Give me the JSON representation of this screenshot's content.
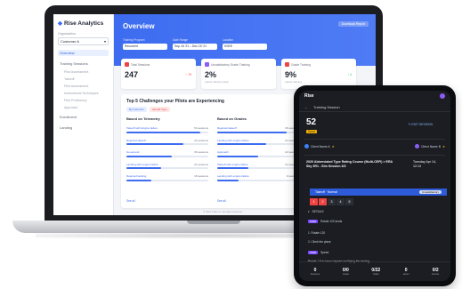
{
  "colors": {
    "accent": "#3d6cf0",
    "score_badge": "#f5b301",
    "alert_red": "#ef4444",
    "purple_tag": "#7c4dff"
  },
  "laptop": {
    "sidebar": {
      "brand": "Rise Analytics",
      "org_label": "Organization",
      "org_value": "Customer A",
      "items": [
        {
          "label": "Overview",
          "active": true
        },
        {
          "label": "Training Sessions",
          "active": false
        },
        {
          "label": "Pilot Assessment",
          "active": false,
          "sub": true
        },
        {
          "label": "Takeoff",
          "active": false,
          "sub": true
        },
        {
          "label": "Pilot Assessment",
          "active": false,
          "sub": true
        },
        {
          "label": "Instructional Techniques",
          "active": false,
          "sub": true
        },
        {
          "label": "Pilot Proficiency",
          "active": false,
          "sub": true
        },
        {
          "label": "Approach",
          "active": false,
          "sub": true
        },
        {
          "label": "Enrollment",
          "active": false
        },
        {
          "label": "Landing",
          "active": false
        }
      ]
    },
    "header": {
      "title": "Overview",
      "button": "Download Report"
    },
    "filters": [
      {
        "label": "Training Program",
        "value": "Recurrent"
      },
      {
        "label": "Date Range",
        "value": "Sep 16 '21 – Dec 15 '21"
      },
      {
        "label": "Location",
        "value": "KSEE"
      }
    ],
    "stats": [
      {
        "label": "Total Sessions",
        "value": "247",
        "delta": "↑ 79",
        "icon_color": "#ef4444",
        "delta_color": "#ef4444"
      },
      {
        "label": "Unsatisfactory Grade Training",
        "value": "2%",
        "sub": "Latest training week",
        "icon_color": "#8b5cf6"
      },
      {
        "label": "Grade Training",
        "value": "9%",
        "delta": "↑ 4",
        "sub": "Latest training",
        "icon_color": "#ef4444",
        "delta_color": "#22c55e"
      }
    ],
    "challenges": {
      "title": "Top 5 Challenges your Pilots are Experiencing",
      "chips": [
        {
          "label": "By Instructor",
          "bg": "#e8efff",
          "fg": "#3d6cf0"
        },
        {
          "label": "Aircraft Type",
          "bg": "#fde8e8",
          "fg": "#ef4444"
        }
      ],
      "col1": {
        "heading": "Based on Telemetry",
        "rows": [
          {
            "label": "Takeoff with Engine failure",
            "count": "54 sessions",
            "fill": 0.9
          },
          {
            "label": "Rejected takeoff",
            "count": "44 sessions",
            "fill": 0.7
          },
          {
            "label": "Go-around",
            "count": "36 sessions",
            "fill": 0.55
          },
          {
            "label": "Landing with engine failure",
            "count": "24 sessions",
            "fill": 0.42
          },
          {
            "label": "Rejected landing",
            "count": "18 sessions",
            "fill": 0.3
          }
        ],
        "see_all": "See all"
      },
      "col2": {
        "heading": "Based on Grades",
        "rows": [
          {
            "label": "Rejected takeoff",
            "count": "36 sessions",
            "fill": 0.85
          },
          {
            "label": "Landing with engine failure",
            "count": "24 sessions",
            "fill": 0.6
          },
          {
            "label": "Approach",
            "count": "22 sessions",
            "fill": 0.5
          },
          {
            "label": "Takeoff with engine failure",
            "count": "14 sessions",
            "fill": 0.38
          },
          {
            "label": "Landing with engine failure",
            "count": "9 sessions",
            "fill": 0.26
          }
        ],
        "see_all": "See all"
      }
    },
    "right_panel": {
      "title": "Te..."
    },
    "footer": "© 2021 CAE Inc. All rights reserved."
  },
  "tablet": {
    "brand": "Rise",
    "nav": [
      "←",
      "Training Session"
    ],
    "score": "52",
    "badge": "Good",
    "link": "✎ EDIT SESSION",
    "people": [
      {
        "name": "Client Name A",
        "star": "★",
        "color": "#3b82f6"
      },
      {
        "name": "Client Name B",
        "star": "★",
        "color": "#8b5cf6"
      }
    ],
    "course": "2020 Abbreviated Type Rating Course (Multi-CEFI) > ERA Sky 3R1 - Sim Session 3/3",
    "date": "Tuesday Apr 14, 12:13",
    "section": {
      "label": "Takeoff · Normal",
      "pill": "Unsatisfactory"
    },
    "grades": [
      {
        "v": "1",
        "bg": "#ef4444"
      },
      {
        "v": "2",
        "bg": "#ef4444"
      },
      {
        "v": "3",
        "bg": "#2b2e35"
      },
      {
        "v": "4",
        "bg": "#2b2e35"
      },
      {
        "v": "5",
        "bg": "#2b2e35"
      }
    ],
    "details_label": "DETAILS",
    "tags": [
      {
        "tag": "TASK",
        "text": "Rotate 120 knots"
      },
      {
        "tag": "",
        "text": "1. Rotate 120"
      },
      {
        "tag": "",
        "text": "2. Climb the plane"
      },
      {
        "tag": "TASK",
        "text": "Speed"
      },
      {
        "tag": "",
        "text": "Rotate 1.5 to know Vspeed and flying the landing"
      }
    ],
    "stats": [
      {
        "v": "0",
        "l": "Sessions"
      },
      {
        "v": "0/0",
        "l": "Goals"
      },
      {
        "v": "0/22",
        "l": "Tasks"
      },
      {
        "v": "0",
        "l": "Hours"
      },
      {
        "v": "0/2",
        "l": "Events"
      }
    ]
  }
}
